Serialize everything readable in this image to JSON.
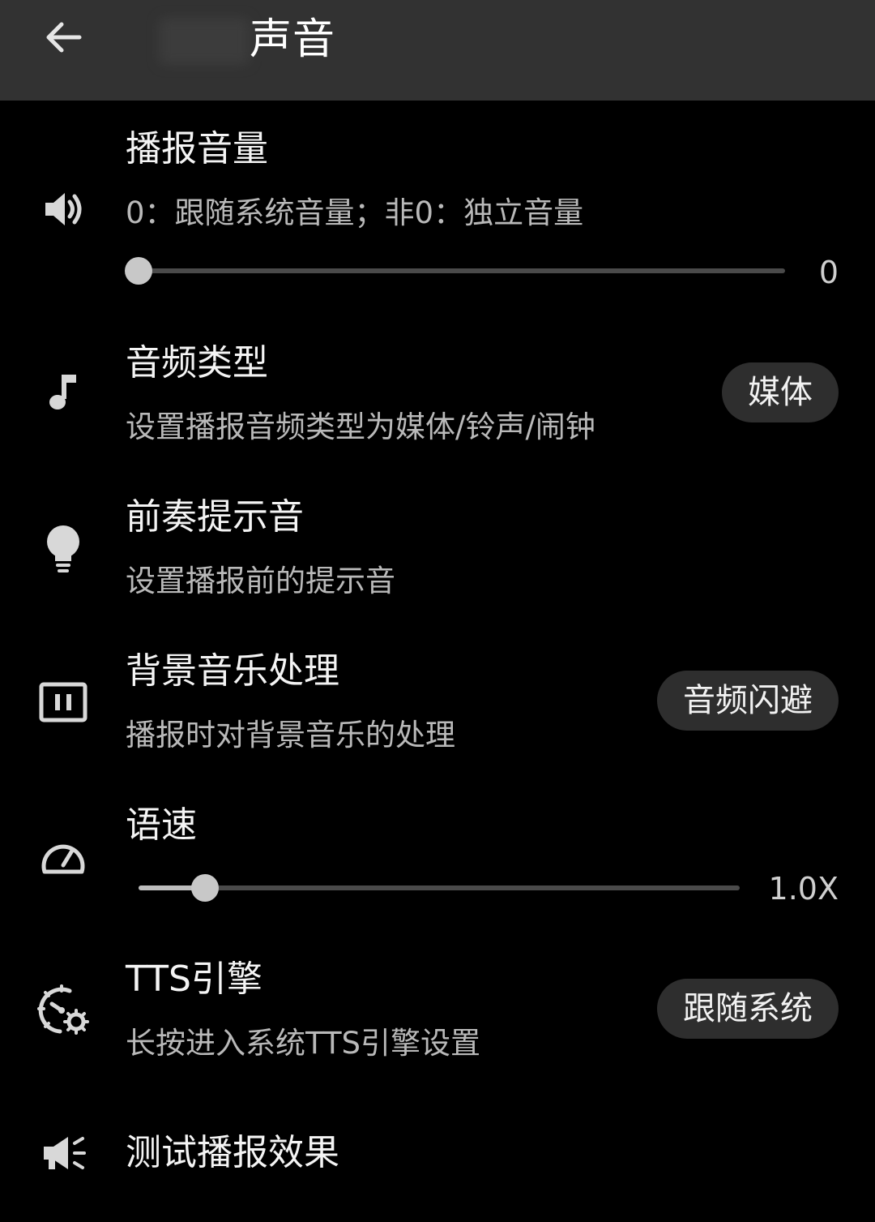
{
  "appbar": {
    "title": "声音",
    "back_icon": "arrow-left-icon"
  },
  "settings": {
    "volume": {
      "icon": "speaker-icon",
      "title": "播报音量",
      "subtitle": "0：跟随系统音量；非0：独立音量",
      "value_label": "0",
      "slider_fraction": 0.0
    },
    "audio_type": {
      "icon": "music-note-icon",
      "title": "音频类型",
      "subtitle": "设置播报音频类型为媒体/铃声/闹钟",
      "value": "媒体"
    },
    "prelude": {
      "icon": "lightbulb-icon",
      "title": "前奏提示音",
      "subtitle": "设置播报前的提示音"
    },
    "background_music": {
      "icon": "pause-box-icon",
      "title": "背景音乐处理",
      "subtitle": "播报时对背景音乐的处理",
      "value": "音频闪避"
    },
    "speech_rate": {
      "icon": "speedometer-icon",
      "title": "语速",
      "value_label": "1.0X",
      "slider_fraction": 0.11
    },
    "tts_engine": {
      "icon": "gear-clock-icon",
      "title": "TTS引擎",
      "subtitle": "长按进入系统TTS引擎设置",
      "value": "跟随系统"
    },
    "test": {
      "icon": "megaphone-icon",
      "title": "测试播报效果"
    }
  }
}
